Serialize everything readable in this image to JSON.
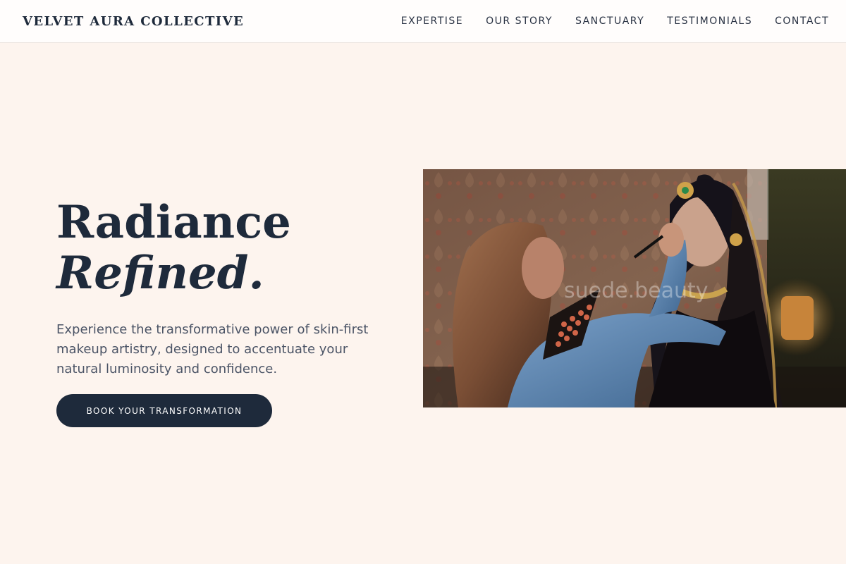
{
  "header": {
    "brand": "VELVET AURA COLLECTIVE",
    "nav": [
      "EXPERTISE",
      "OUR STORY",
      "SANCTUARY",
      "TESTIMONIALS",
      "CONTACT"
    ]
  },
  "hero": {
    "title_line1": "Radiance",
    "title_line2": "Refined.",
    "description": "Experience the transformative power of skin-first makeup artistry, designed to accentuate your natural luminosity and confidence.",
    "cta_label": "BOOK YOUR TRANSFORMATION",
    "image_watermark": "suede.beauty"
  },
  "colors": {
    "background": "#fdf4ee",
    "header_bg": "#fffdfc",
    "primary_dark": "#1e2a3b",
    "body_text": "#4b5466"
  }
}
